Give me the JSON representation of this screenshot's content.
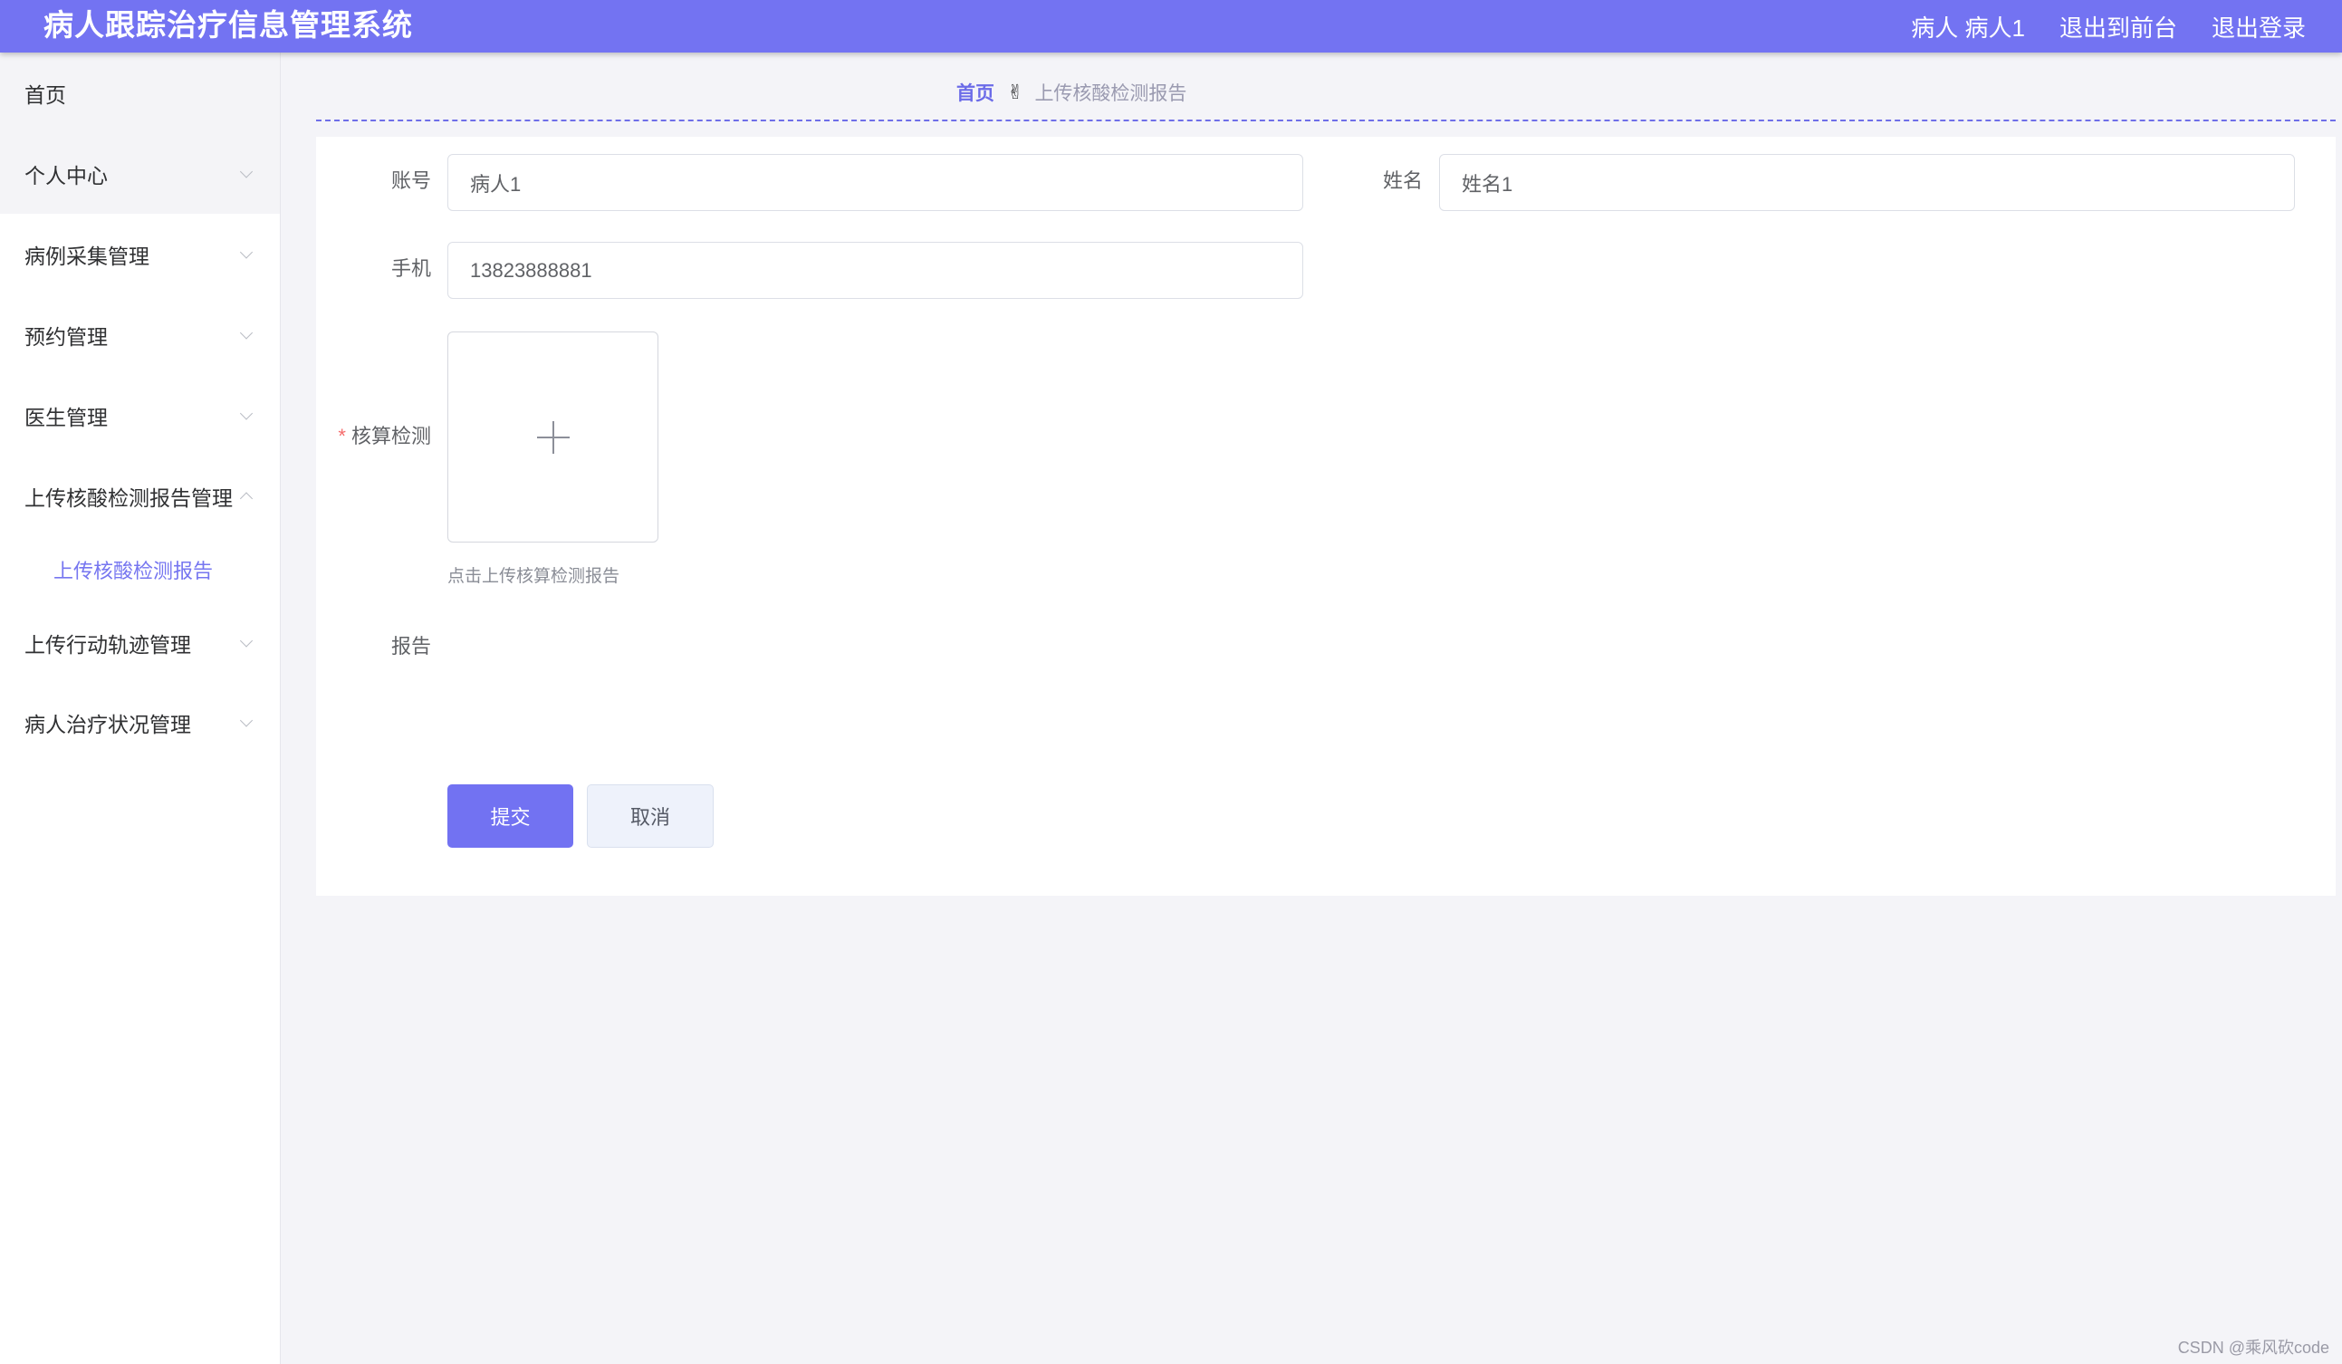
{
  "header": {
    "title": "病人跟踪治疗信息管理系统",
    "user": "病人 病人1",
    "to_front": "退出到前台",
    "logout": "退出登录"
  },
  "sidebar": {
    "items": [
      {
        "label": "首页"
      },
      {
        "label": "个人中心"
      },
      {
        "label": "病例采集管理"
      },
      {
        "label": "预约管理"
      },
      {
        "label": "医生管理"
      },
      {
        "label": "上传核酸检测报告管理"
      },
      {
        "label": "上传行动轨迹管理"
      },
      {
        "label": "病人治疗状况管理"
      }
    ],
    "submenu_active": "上传核酸检测报告"
  },
  "breadcrumb": {
    "home": "首页",
    "separator": "✌",
    "current": "上传核酸检测报告"
  },
  "form": {
    "account_label": "账号",
    "account_value": "病人1",
    "name_label": "姓名",
    "name_value": "姓名1",
    "phone_label": "手机",
    "phone_value": "13823888881",
    "required_mark": "*",
    "test_label": "核算检测",
    "upload_hint": "点击上传核算检测报告",
    "report_label": "报告",
    "submit": "提交",
    "cancel": "取消"
  },
  "watermark": "CSDN @乘风砍code",
  "colors": {
    "header_bg": "#7373f2",
    "accent": "#7676f0",
    "primary_button": "#7272f2"
  }
}
